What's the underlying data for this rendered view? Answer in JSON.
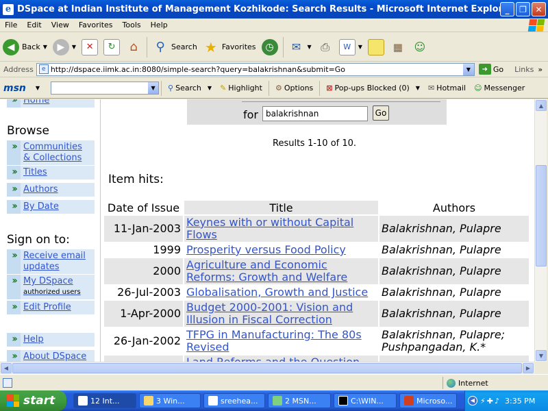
{
  "window": {
    "title": "DSpace at Indian Institute of Management Kozhikode: Search Results - Microsoft Internet Explorer"
  },
  "menu": [
    "File",
    "Edit",
    "View",
    "Favorites",
    "Tools",
    "Help"
  ],
  "toolbar": {
    "back": "Back",
    "search": "Search",
    "favorites": "Favorites"
  },
  "address": {
    "label": "Address",
    "url": "http://dspace.iimk.ac.in:8080/simple-search?query=balakrishnan&submit=Go",
    "go": "Go",
    "links": "Links"
  },
  "msn": {
    "logo": "msn",
    "search": "Search",
    "highlight": "Highlight",
    "options": "Options",
    "popups": "Pop-ups Blocked (0)",
    "hotmail": "Hotmail",
    "messenger": "Messenger"
  },
  "sidebar": {
    "home": "Home",
    "browse_heading": "Browse",
    "browse_items": [
      {
        "label": "Communities",
        "label2": "& Collections"
      },
      {
        "label": "Titles"
      },
      {
        "label": "Authors"
      },
      {
        "label": "By Date"
      }
    ],
    "signon_heading": "Sign on to:",
    "signon_items": [
      {
        "label": "Receive email",
        "label2": "updates"
      },
      {
        "label": "My DSpace",
        "sub": "authorized users"
      },
      {
        "label": "Edit Profile"
      }
    ],
    "help": "Help",
    "about": "About DSpace"
  },
  "search": {
    "for_label": "for",
    "query": "balakrishnan",
    "go": "Go",
    "results": "Results 1-10 of 10.",
    "item_hits": "Item hits:"
  },
  "table": {
    "headers": [
      "Date of Issue",
      "Title",
      "Authors"
    ],
    "rows": [
      {
        "date": "11-Jan-2003",
        "title": "Keynes with or without Capital Flows",
        "authors": "Balakrishnan, Pulapre"
      },
      {
        "date": "1999",
        "title": "Prosperity versus Food Policy",
        "authors": "Balakrishnan, Pulapre"
      },
      {
        "date": "2000",
        "title": "Agriculture and Economic Reforms: Growth and Welfare",
        "authors": "Balakrishnan, Pulapre"
      },
      {
        "date": "26-Jul-2003",
        "title": "Globalisation, Growth and Justice",
        "authors": "Balakrishnan, Pulapre"
      },
      {
        "date": "1-Apr-2000",
        "title": "Budget 2000-2001: Vision and Illusion in Fiscal Correction",
        "authors": "Balakrishnan, Pulapre"
      },
      {
        "date": "26-Jan-2002",
        "title": "TFPG in Manufacturing: The 80s Revised",
        "authors": "Balakrishnan, Pulapre; Pushpangadan, K.*"
      },
      {
        "date": "",
        "title": "Land Reforms and the Question",
        "authors": ""
      }
    ]
  },
  "status": {
    "zone": "Internet"
  },
  "taskbar": {
    "start": "start",
    "tasks": [
      "12 Int...",
      "3 Win...",
      "sreehea...",
      "2 MSN...",
      "C:\\WIN...",
      "Microso..."
    ],
    "clock": "3:35 PM"
  }
}
